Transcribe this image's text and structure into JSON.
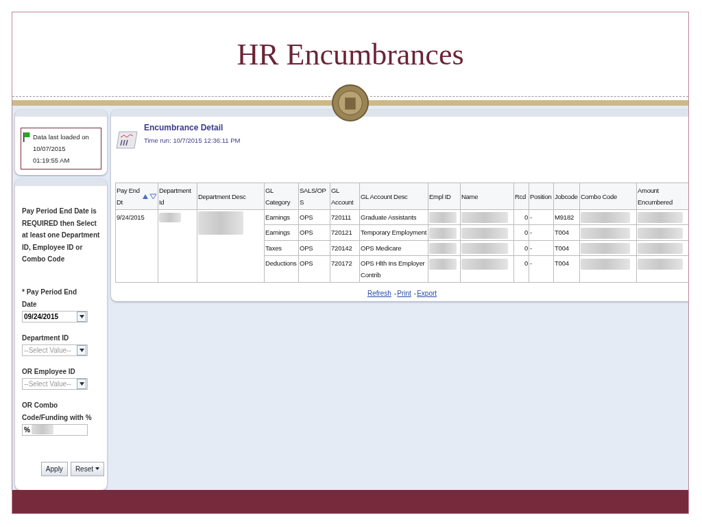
{
  "slide_title": "HR Encumbrances",
  "load_status": {
    "text_lines": [
      "Data last loaded on",
      "10/07/2015",
      "01:19:55 AM"
    ]
  },
  "prompts": {
    "instructions": "Pay Period End Date is REQUIRED then Select at least one Department ID, Employee ID or Combo Code",
    "fields": [
      {
        "label": "* Pay Period End Date",
        "value": "09/24/2015",
        "kind": "dropdown"
      },
      {
        "label": "Department ID",
        "placeholder": "--Select Value--",
        "kind": "dropdown"
      },
      {
        "label": "OR Employee ID",
        "placeholder": "--Select Value--",
        "kind": "dropdown"
      },
      {
        "label": "OR Combo Code/Funding with %",
        "value": "%",
        "kind": "text"
      }
    ],
    "buttons": [
      {
        "label": "Apply",
        "kind": "plain"
      },
      {
        "label": "Reset",
        "kind": "menu"
      }
    ]
  },
  "report": {
    "title": "Encumbrance Detail",
    "time_run": "Time run: 10/7/2015 12:36:11 PM",
    "table": {
      "columns": [
        "Pay End Dt",
        "Department Id",
        "Department Desc",
        "GL Category",
        "SALS/OPS",
        "GL Account",
        "GL Account Desc",
        "Empl ID",
        "Name",
        "Rcd",
        "Position",
        "Jobcode",
        "Combo Code",
        "Amount Encumbered"
      ],
      "rows": [
        {
          "cells": [
            {
              "text": "9/24/2015",
              "rowspan": 4
            },
            {
              "text": null,
              "rowspan": 4
            },
            {
              "text": null,
              "rowspan": 4
            },
            "Earnings",
            "OPS",
            "720111",
            "Graduate Assistants",
            null,
            null,
            "0",
            "-",
            "M9182",
            null,
            null
          ]
        },
        {
          "cells": [
            "Earnings",
            "OPS",
            "720121",
            "Temporary Employment",
            null,
            null,
            "0",
            "-",
            "T004",
            null,
            null
          ]
        },
        {
          "cells": [
            "Taxes",
            "OPS",
            "720142",
            "OPS Medicare",
            null,
            null,
            "0",
            "-",
            "T004",
            null,
            null
          ]
        },
        {
          "cells": [
            "Deductions",
            "OPS",
            "720172",
            "OPS Hlth Ins Employer Contrib",
            null,
            null,
            "0",
            "-",
            "T004",
            null,
            null
          ]
        }
      ]
    },
    "links": [
      {
        "label": "Refresh"
      },
      {
        "separator": "-",
        "label": "Print"
      },
      {
        "separator": "-",
        "label": "Export"
      }
    ]
  }
}
